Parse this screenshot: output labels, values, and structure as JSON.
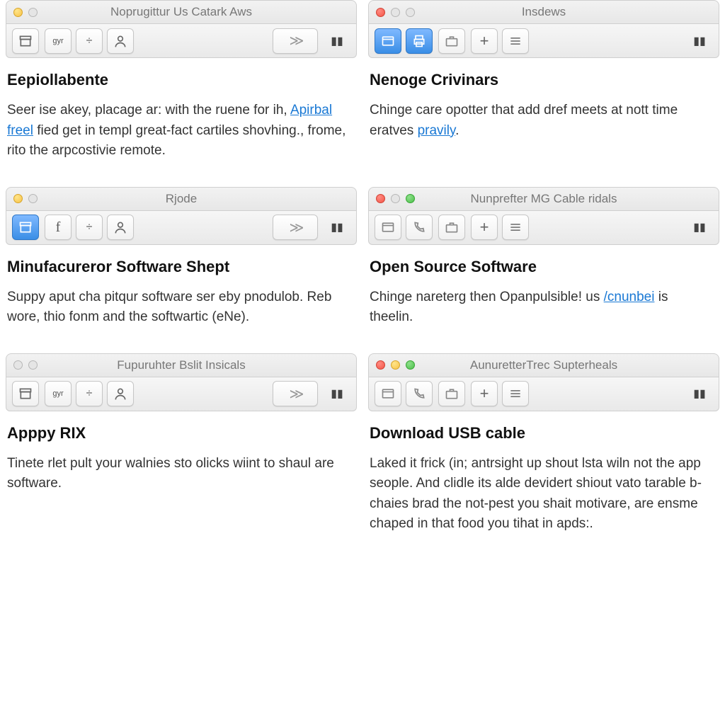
{
  "panels": [
    {
      "window_title": "Noprugittur Us Catark Aws",
      "traffic": [
        "yellow",
        "dim"
      ],
      "toolbar_variant": "A",
      "heading": "Eepiollabente",
      "body_pre": "Seer ise akey, placage ar: with the ruene for ih, ",
      "link": "Apirbal freel",
      "body_post": " fied get in templ great-fact cartiles shovhing., frome, rito the arpcostivie remote."
    },
    {
      "window_title": "Insdews",
      "traffic": [
        "red",
        "dim",
        "dim"
      ],
      "toolbar_variant": "B",
      "heading": "Nenoge Crivinars",
      "body_pre": "Chinge care opotter that add dref meets at nott time eratves ",
      "link": "pravily",
      "body_post": "."
    },
    {
      "window_title": "Rjode",
      "traffic": [
        "yellow",
        "dim"
      ],
      "toolbar_variant": "C",
      "heading": "Minufacureror Software Shept",
      "body_pre": "Suppy aput cha pitqur software ser eby pnodulob. Reb wore, thio fonm and the softwartic (eNe).",
      "link": "",
      "body_post": ""
    },
    {
      "window_title": "Nunprefter MG Cable ridals",
      "traffic": [
        "red",
        "dim",
        "green"
      ],
      "toolbar_variant": "D",
      "heading": "Open Source Software",
      "body_pre": "Chinge nareterg then Opanpulsible! us ",
      "link": "/cnunbei",
      "body_post": " is theelin."
    },
    {
      "window_title": "Fupuruhter Bslit Insicals",
      "traffic": [
        "dim",
        "dim"
      ],
      "toolbar_variant": "A",
      "heading": "Apppy RIX",
      "body_pre": "Tinete rlet pult your walnies sto olicks wiint to shaul are software.",
      "link": "",
      "body_post": ""
    },
    {
      "window_title": "AunuretterTrec Supterheals",
      "traffic": [
        "red",
        "yellow",
        "green"
      ],
      "toolbar_variant": "D",
      "heading": "Download USB cable",
      "body_pre": "Laked it frick (in; antrsight up shout lsta wiln not the app seople. And clidle its alde devidert shiout vato tarable b-chaies brad the not-pest you shait motivare, are ensme chaped in that food you tihat in apds:.",
      "link": "",
      "body_post": ""
    }
  ],
  "icons": {
    "globe": "◉",
    "archive": "⌸",
    "divide": "÷",
    "person": "8",
    "fwd": "≫",
    "columns": "▯▮",
    "window": "⌸",
    "print": "⎙",
    "briefcase": "🗄",
    "plus": "+",
    "list": "☰",
    "f": "f",
    "phone": "✆"
  }
}
